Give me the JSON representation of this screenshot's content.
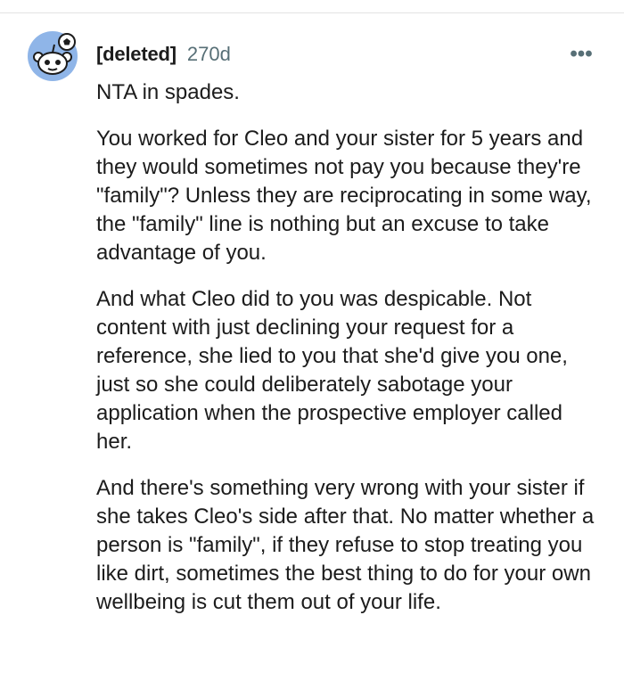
{
  "comment": {
    "username": "[deleted]",
    "age": "270d",
    "more_label": "•••",
    "paragraphs": [
      "NTA in spades.",
      "You worked for Cleo and your sister for 5 years and they would sometimes not pay you because they're \"family\"? Unless they are reciprocating in some way, the \"family\" line is nothing but an excuse to take advantage of you.",
      "And what Cleo did to you was despicable. Not content with just declining your request for a reference, she lied to you that she'd give you one, just so she could deliberately sabotage your application when the prospective employer called her.",
      "And there's something very wrong with your sister if she takes Cleo's side after that. No matter whether a person is \"family\", if they refuse to stop treating you like dirt, sometimes the best thing to do for your own wellbeing is cut them out of your life."
    ]
  },
  "icons": {
    "avatar": "snoo-avatar-icon",
    "more": "more-options-icon"
  },
  "colors": {
    "avatar_bg": "#8fb5e8",
    "text": "#1c1c1c",
    "meta": "#576f76"
  }
}
